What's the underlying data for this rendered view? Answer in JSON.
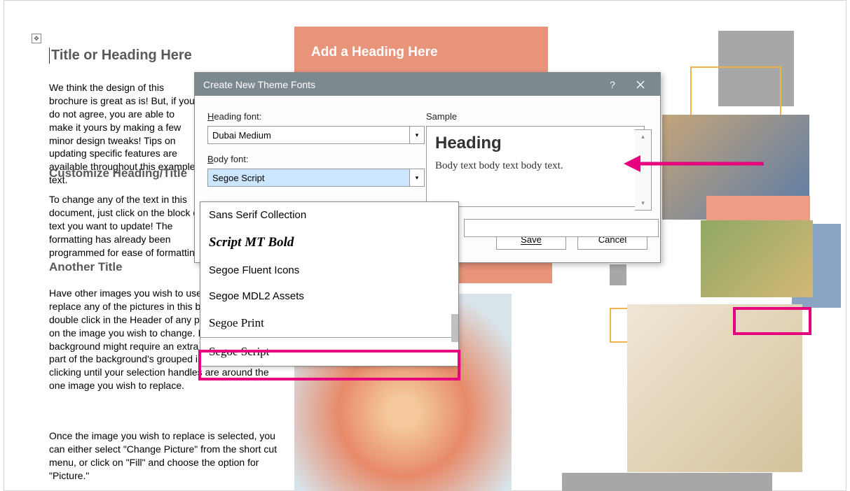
{
  "document": {
    "title": "Title or Heading Here",
    "p1": "We think the design of this brochure is great as is!  But, if you do not agree, you are able to make it yours by making a few minor design tweaks!  Tips on updating specific features are available throughout this example text.",
    "h2a": "Customize Heading/Title",
    "p2": "To change any of the text in this document, just click on the block of text you want to update!  The formatting has already been programmed for ease of formatting.",
    "h2b": "Another Title",
    "p3": "Have other images you wish to use?  It is simple to replace any of the pictures in this brochure.  Simply double click in the Header of any page.  Click twice on the image you wish to change.  Images in the background might require an extra click as they are part of the background's grouped images.  Keep clicking until your selection handles are around the one image you wish to replace.",
    "p4": "Once the image you wish to replace is selected, you can either select \"Change Picture\" from the short cut menu, or click on \"Fill\" and choose the option for \"Picture.\"",
    "banner": "Add a Heading Here"
  },
  "dialog": {
    "title": "Create New Theme Fonts",
    "help": "?",
    "heading_font_label_pre": "H",
    "heading_font_label_rest": "eading font:",
    "heading_font_value": "Dubai Medium",
    "body_font_label_pre": "B",
    "body_font_label_rest": "ody font:",
    "body_font_value": "Segoe Script",
    "sample_label": "Sample",
    "sample_heading": "Heading",
    "sample_body": "Body text body text body text.",
    "save_label": "Save",
    "cancel_label": "Cancel"
  },
  "dropdown": {
    "options": [
      "Sans Serif Collection",
      "Script MT Bold",
      "Segoe Fluent Icons",
      "Segoe MDL2 Assets",
      "Segoe Print",
      "Segoe Script"
    ]
  }
}
